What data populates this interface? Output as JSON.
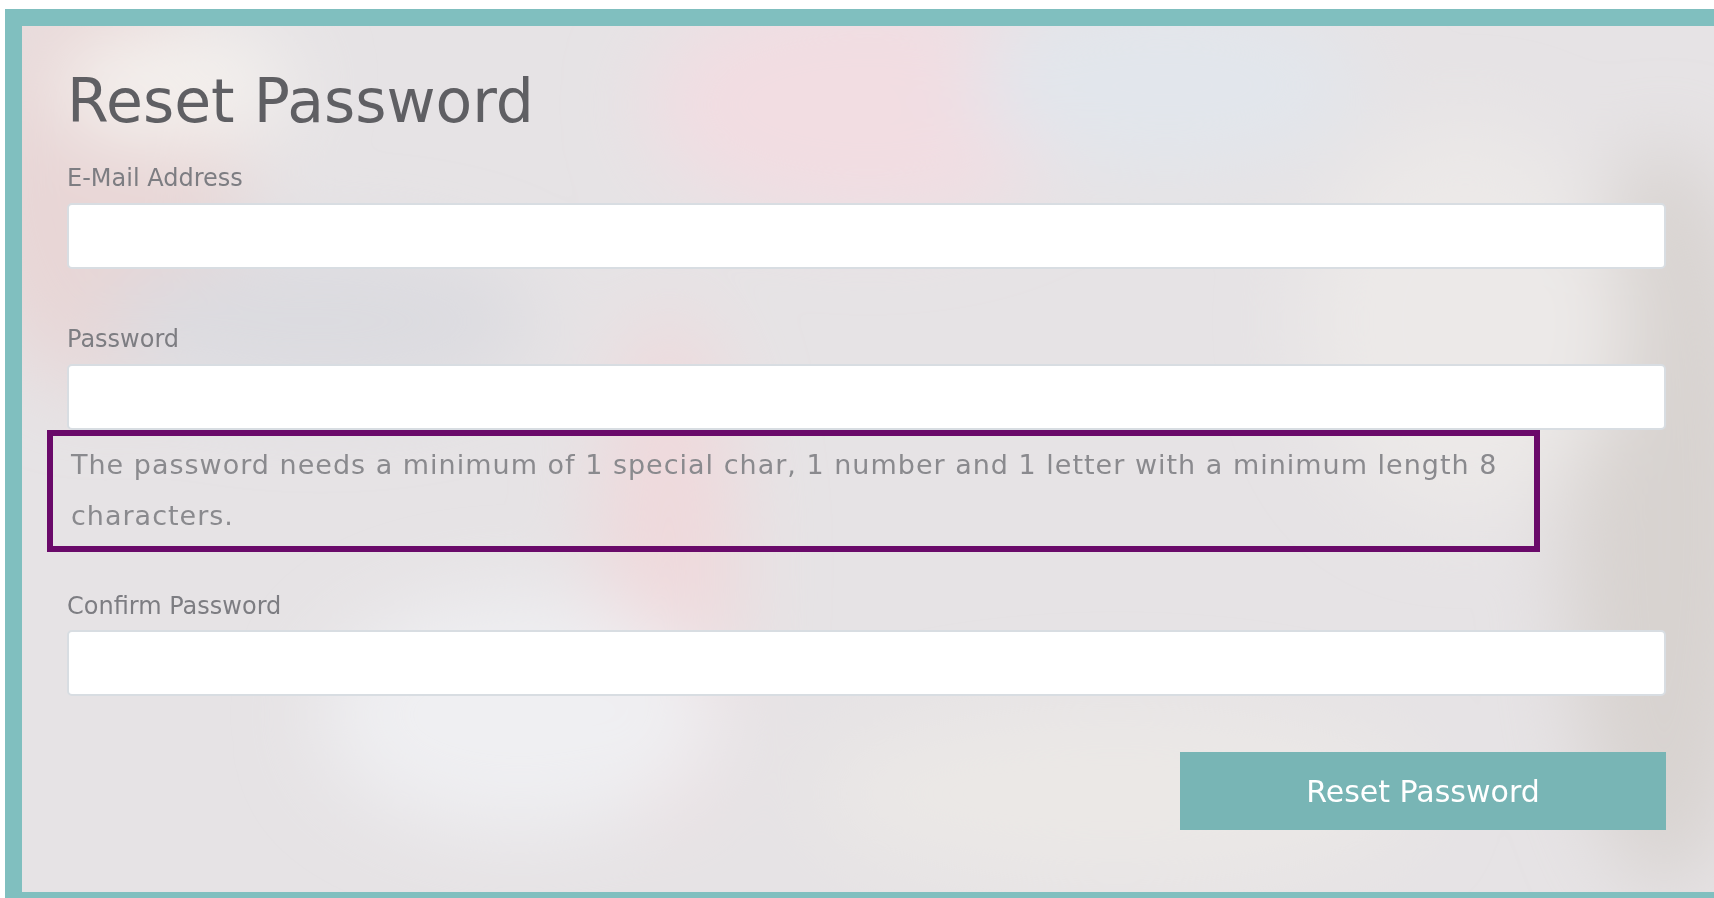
{
  "title": "Reset Password",
  "fields": [
    {
      "label": "E-Mail Address"
    },
    {
      "label": "Password",
      "hint": {
        "text": "The password needs a minimum of 1 special char, 1 number and 1 letter with a minimum length 8 characters.",
        "highlighted": true
      }
    },
    {
      "label": "Confirm Password"
    }
  ],
  "submit_button": "Reset Password"
}
